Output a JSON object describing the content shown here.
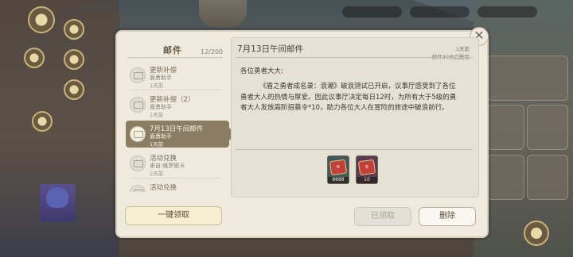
{
  "list": {
    "title": "邮件",
    "count": "12/200",
    "items": [
      {
        "title": "更新补偿",
        "sender": "盾勇助手",
        "age": "1天前"
      },
      {
        "title": "更新补偿（2）",
        "sender": "盾勇助手",
        "age": "1天前"
      },
      {
        "title": "7月13日午间邮件",
        "sender": "盾勇助手",
        "age": "1天前"
      },
      {
        "title": "活动兑换",
        "sender": "来自:维罗妮卡",
        "age": "2天前"
      },
      {
        "title": "活动兑换",
        "sender": "",
        "age": ""
      }
    ]
  },
  "mail": {
    "title": "7月13日午间邮件",
    "age": "1天前",
    "expiry": "邮件30天后删除",
    "greeting": "各位勇者大大:",
    "body": "《盾之勇者成名录：浪潮》破浪测试已开启，议事厅感受到了各位勇者大人的热情与厚爱。因此议事厅决定每日12时，为所有大于5级的勇者大人发放高阶招募令*10，助力各位大人在冒险的旅途中破浪前行。",
    "attachments": [
      {
        "icon": "recruit-ticket-icon",
        "quantity": "8888",
        "color": "#3f5a5d"
      },
      {
        "icon": "recruit-ticket-icon",
        "quantity": "10",
        "color": "#5a3b57"
      }
    ]
  },
  "buttons": {
    "claim_all": "一键领取",
    "claimed": "已领取",
    "delete": "删除",
    "close": "✕"
  }
}
